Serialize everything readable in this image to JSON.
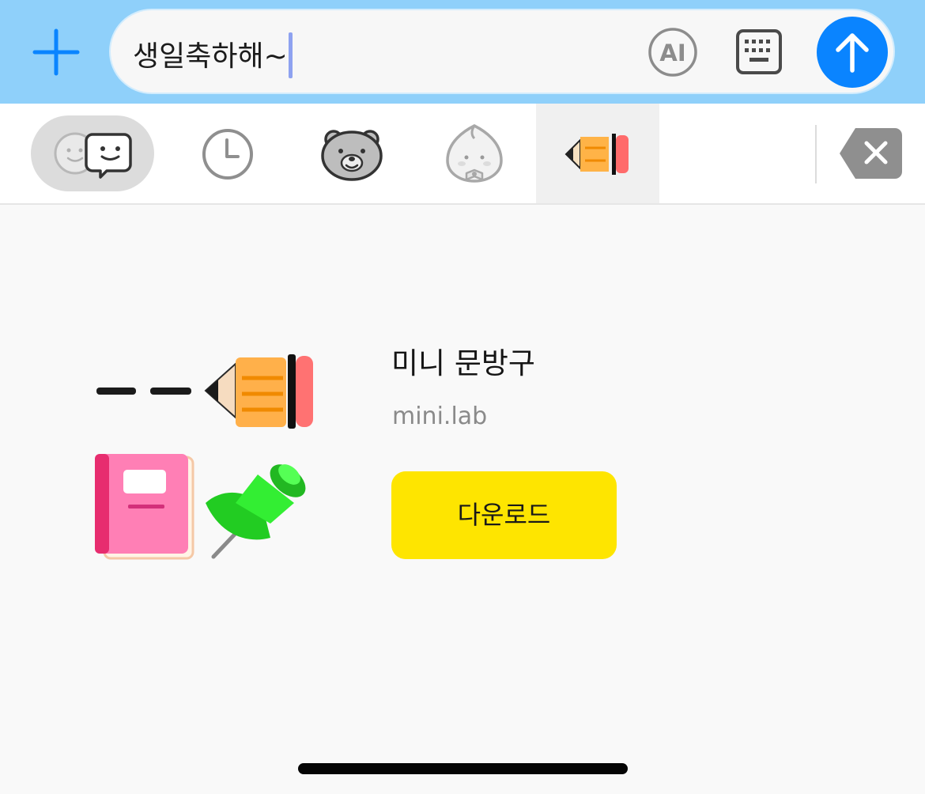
{
  "composer": {
    "message_text": "생일축하해~",
    "ai_label": "AI",
    "add_icon": "plus-icon",
    "keyboard_icon": "keyboard-icon",
    "send_icon": "arrow-up-icon"
  },
  "tabs": [
    {
      "icon": "emoji-faces-icon",
      "selected_group": true
    },
    {
      "icon": "clock-icon"
    },
    {
      "icon": "bear-face-icon"
    },
    {
      "icon": "peach-character-icon"
    },
    {
      "icon": "pencil-sticker-icon",
      "active": true
    }
  ],
  "pack": {
    "title": "미니 문방구",
    "author": "mini.lab",
    "download_label": "다운로드"
  },
  "colors": {
    "top_bar": "#8fd0fa",
    "accent_blue": "#0a84ff",
    "download_yellow": "#fee500",
    "background": "#f9f9f9"
  }
}
